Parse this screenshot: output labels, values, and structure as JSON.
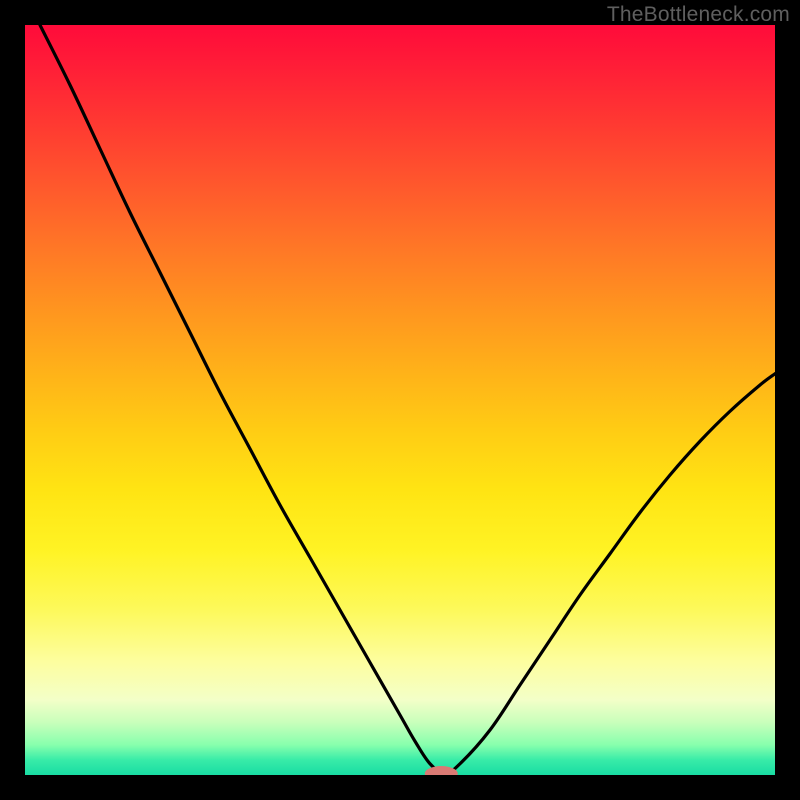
{
  "watermark": "TheBottleneck.com",
  "chart_data": {
    "type": "line",
    "title": "",
    "xlabel": "",
    "ylabel": "",
    "xlim": [
      0,
      100
    ],
    "ylim": [
      0,
      100
    ],
    "grid": false,
    "legend": false,
    "background_gradient": {
      "direction": "top-to-bottom",
      "stops": [
        {
          "pos": 0.0,
          "color": "#ff0b3a"
        },
        {
          "pos": 0.25,
          "color": "#ff6a2a"
        },
        {
          "pos": 0.5,
          "color": "#ffc118"
        },
        {
          "pos": 0.75,
          "color": "#fcf749"
        },
        {
          "pos": 0.9,
          "color": "#f4ffc9"
        },
        {
          "pos": 1.0,
          "color": "#19dca3"
        }
      ]
    },
    "series": [
      {
        "name": "bottleneck-curve",
        "x": [
          2,
          6,
          10,
          14,
          18,
          22,
          26,
          30,
          34,
          38,
          42,
          46,
          50,
          52,
          54,
          56,
          58,
          62,
          66,
          70,
          74,
          78,
          82,
          86,
          90,
          94,
          98,
          100
        ],
        "y": [
          100,
          92,
          83.5,
          75,
          67,
          59,
          51,
          43.5,
          36,
          29,
          22,
          15,
          8,
          4.5,
          1.5,
          0.2,
          1.5,
          6,
          12,
          18,
          24,
          29.5,
          35,
          40,
          44.5,
          48.5,
          52,
          53.5
        ]
      }
    ],
    "marker": {
      "name": "optimum-marker",
      "x": 55.5,
      "y": 0.2,
      "rx": 2.2,
      "ry": 1.0,
      "color": "#d97a74"
    }
  }
}
